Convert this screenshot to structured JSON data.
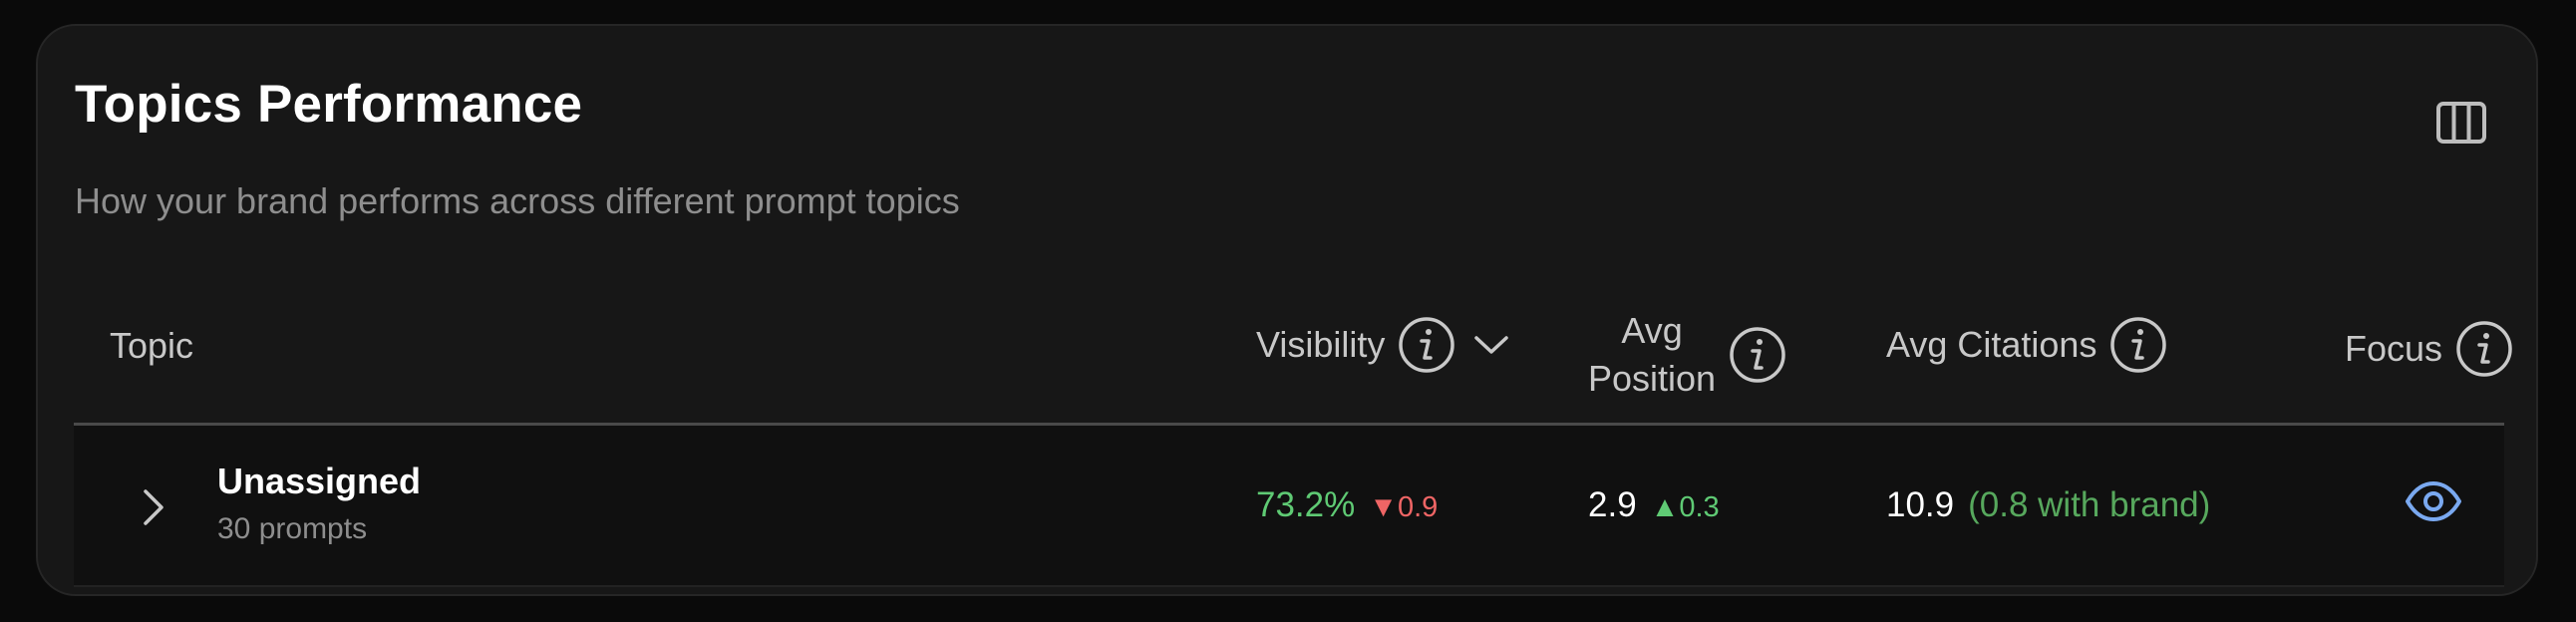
{
  "card": {
    "title": "Topics Performance",
    "subtitle": "How your brand performs across different prompt topics",
    "columns_icon": "columns-icon"
  },
  "table": {
    "headers": {
      "topic": "Topic",
      "visibility": "Visibility",
      "avg_position_line1": "Avg",
      "avg_position_line2": "Position",
      "avg_citations": "Avg Citations",
      "focus": "Focus"
    },
    "rows": [
      {
        "name": "Unassigned",
        "prompts": "30 prompts",
        "visibility": "73.2%",
        "visibility_delta": "▼0.9",
        "avg_position": "2.9",
        "avg_position_delta": "▲0.3",
        "avg_citations": "10.9",
        "citations_with_brand": "(0.8 with brand)",
        "focus_icon": "eye-icon"
      }
    ]
  },
  "colors": {
    "background": "#0a0a0a",
    "card": "#171717",
    "positive": "#5fca74",
    "negative": "#ef6565",
    "focus_icon": "#7aa9f0"
  }
}
